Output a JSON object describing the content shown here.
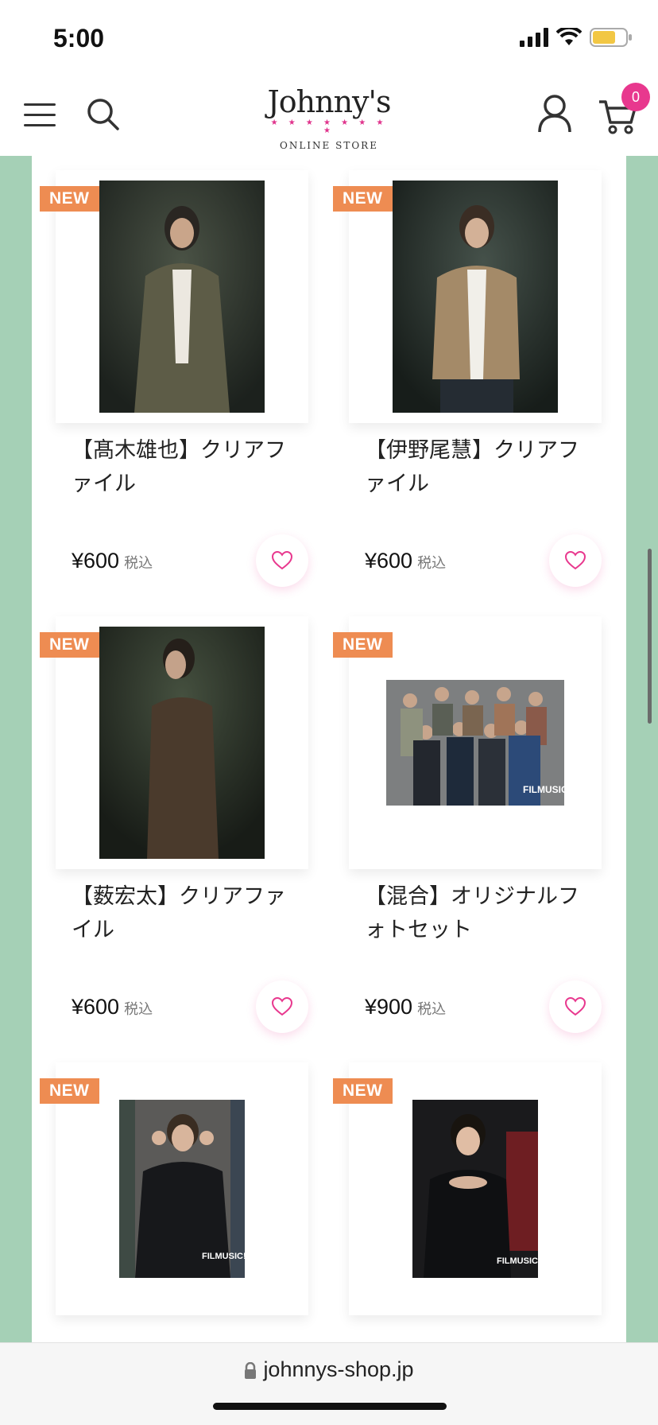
{
  "status": {
    "time": "5:00"
  },
  "header": {
    "logo_main": "Johnny's",
    "logo_sub": "ONLINE STORE",
    "logo_stars": "★ ★ ★ ★ ★ ★ ★ ★",
    "cart_count": "0"
  },
  "products": [
    {
      "badge": "NEW",
      "name": "【髙木雄也】クリアファイル",
      "price": "¥600",
      "tax": "税込",
      "image": "portrait-olive-jacket"
    },
    {
      "badge": "NEW",
      "name": "【伊野尾慧】クリアファイル",
      "price": "¥600",
      "tax": "税込",
      "image": "portrait-beige-jacket"
    },
    {
      "badge": "NEW",
      "name": "【薮宏太】クリアファイル",
      "price": "¥600",
      "tax": "税込",
      "image": "portrait-brown-jacket"
    },
    {
      "badge": "NEW",
      "name": "【混合】オリジナルフォトセット",
      "price": "¥900",
      "tax": "税込",
      "image": "group-photo"
    },
    {
      "badge": "NEW",
      "name": "",
      "price": "",
      "tax": "",
      "image": "photo-black-outfit-peace"
    },
    {
      "badge": "NEW",
      "name": "",
      "price": "",
      "tax": "",
      "image": "photo-black-outfit-seated"
    }
  ],
  "browser": {
    "url": "johnnys-shop.jp"
  },
  "colors": {
    "accent": "#e8388e",
    "badge": "#ee8c52",
    "background": "#a5d0b6"
  }
}
